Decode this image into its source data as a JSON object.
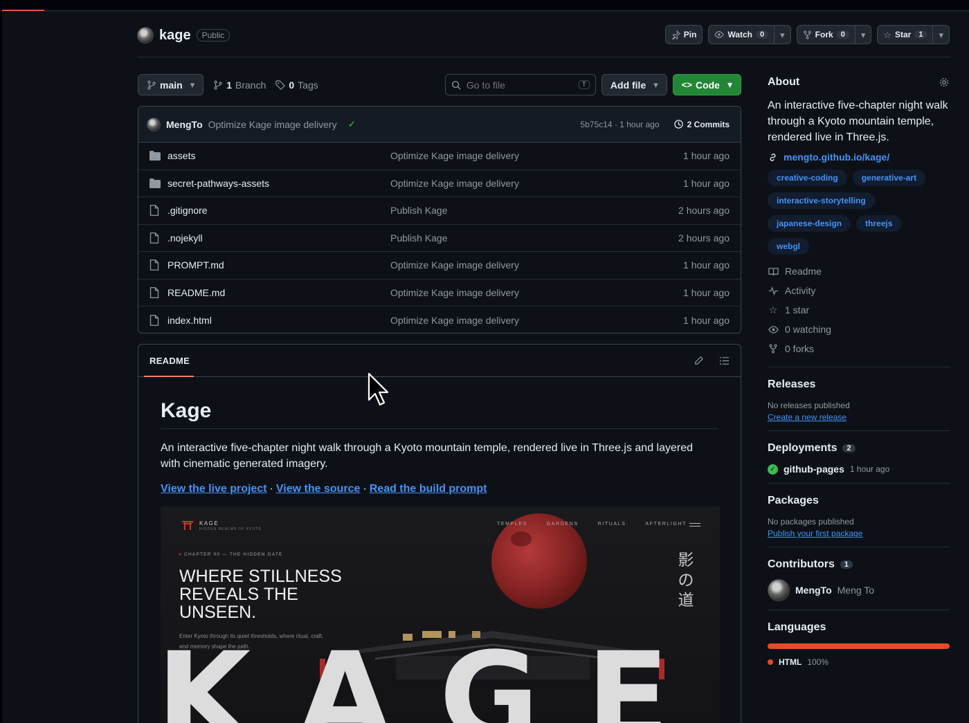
{
  "repo": {
    "name": "kage",
    "visibility": "Public"
  },
  "actions": {
    "pin": "Pin",
    "watch": "Watch",
    "watch_count": "0",
    "fork": "Fork",
    "fork_count": "0",
    "star": "Star",
    "star_count": "1"
  },
  "filenav": {
    "branch": "main",
    "branches_count": "1",
    "branches_label": "Branch",
    "tags_count": "0",
    "tags_label": "Tags",
    "search_placeholder": "Go to file",
    "search_kbd": "T",
    "add_file": "Add file",
    "code": "Code"
  },
  "last_commit": {
    "author": "MengTo",
    "message": "Optimize Kage image delivery",
    "sha_time": "5b75c14 · 1 hour ago",
    "commits": "2 Commits"
  },
  "files": [
    {
      "type": "dir",
      "name": "assets",
      "message": "Optimize Kage image delivery",
      "time": "1 hour ago"
    },
    {
      "type": "dir",
      "name": "secret-pathways-assets",
      "message": "Optimize Kage image delivery",
      "time": "1 hour ago"
    },
    {
      "type": "file",
      "name": ".gitignore",
      "message": "Publish Kage",
      "time": "2 hours ago"
    },
    {
      "type": "file",
      "name": ".nojekyll",
      "message": "Publish Kage",
      "time": "2 hours ago"
    },
    {
      "type": "file",
      "name": "PROMPT.md",
      "message": "Optimize Kage image delivery",
      "time": "1 hour ago"
    },
    {
      "type": "file",
      "name": "README.md",
      "message": "Optimize Kage image delivery",
      "time": "1 hour ago"
    },
    {
      "type": "file",
      "name": "index.html",
      "message": "Optimize Kage image delivery",
      "time": "1 hour ago"
    }
  ],
  "readme": {
    "tab": "README",
    "title": "Kage",
    "description": "An interactive five-chapter night walk through a Kyoto mountain temple, rendered live in Three.js and layered with cinematic generated imagery.",
    "links": [
      "View the live project",
      "View the source",
      "Read the build prompt"
    ],
    "link_separator": "·",
    "hero": {
      "logo": "KAGE",
      "logo_sub": "HIDDEN REALMS OF KYOTO",
      "nav": [
        "TEMPLES",
        "GARDENS",
        "RITUALS",
        "AFTERLIGHT"
      ],
      "chapter": "CHAPTER 00 — THE HIDDEN GATE",
      "headline": "WHERE STILLNESS REVEALS THE UNSEEN.",
      "subtext": "Enter Kyoto through its quiet thresholds, where ritual, craft, and memory shape the path.",
      "kanji": "影の道",
      "big_word": "KAGE"
    }
  },
  "about": {
    "title": "About",
    "description": "An interactive five-chapter night walk through a Kyoto mountain temple, rendered live in Three.js.",
    "homepage": "mengto.github.io/kage/",
    "topics": [
      "creative-coding",
      "generative-art",
      "interactive-storytelling",
      "japanese-design",
      "threejs",
      "webgl"
    ],
    "readme": "Readme",
    "activity": "Activity",
    "stars": "1 star",
    "watching": "0 watching",
    "forks": "0 forks"
  },
  "releases": {
    "title": "Releases",
    "empty": "No releases published",
    "link": "Create a new release"
  },
  "deployments": {
    "title": "Deployments",
    "count": "2",
    "env": "github-pages",
    "time": "1 hour ago"
  },
  "packages": {
    "title": "Packages",
    "empty": "No packages published",
    "link": "Publish your first package"
  },
  "contributors": {
    "title": "Contributors",
    "count": "1",
    "login": "MengTo",
    "name": "Meng To"
  },
  "languages": {
    "title": "Languages",
    "name": "HTML",
    "percent": "100%",
    "html_share": 1.0,
    "color": "#e34c26"
  }
}
